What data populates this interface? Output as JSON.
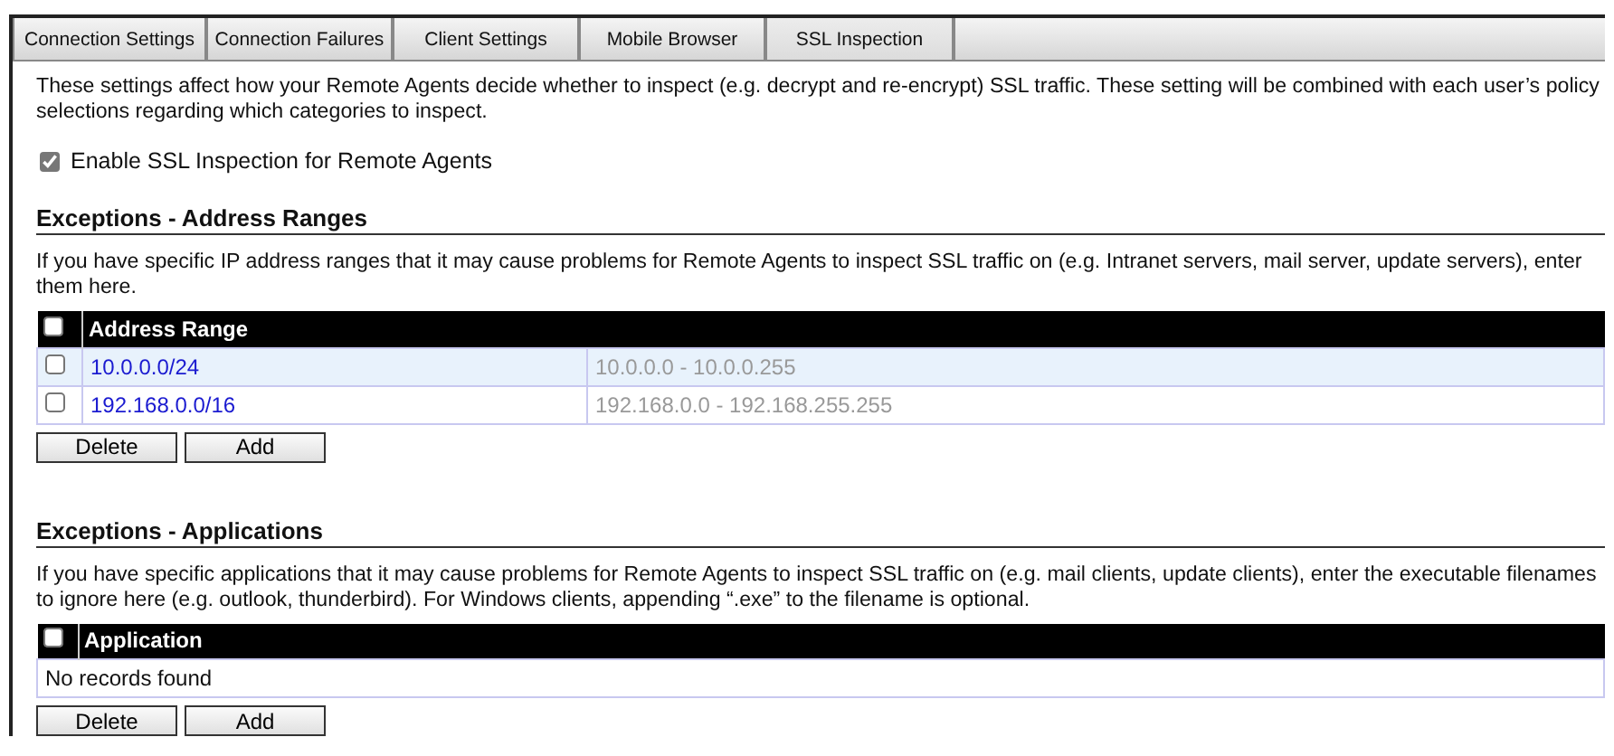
{
  "tabs": [
    {
      "label": "Connection Settings",
      "selected": false
    },
    {
      "label": "Connection Failures",
      "selected": false
    },
    {
      "label": "Client Settings",
      "selected": false
    },
    {
      "label": "Mobile Browser",
      "selected": false
    },
    {
      "label": "SSL Inspection",
      "selected": true
    }
  ],
  "intro": "These settings affect how your Remote Agents decide whether to inspect (e.g. decrypt and re-encrypt) SSL traffic. These setting will be combined with each user’s policy selections regarding which categories to inspect.",
  "enable_option": {
    "label": "Enable SSL Inspection for Remote Agents",
    "checked": true
  },
  "sections": [
    {
      "heading": "Exceptions - Address Ranges",
      "description": "If you have specific IP address ranges that it may cause problems for Remote Agents to inspect SSL traffic on (e.g. Intranet servers, mail server, update servers), enter them here.",
      "table": {
        "header_checked": false,
        "column": "Address Range",
        "rows": [
          {
            "checked": false,
            "highlighted": true,
            "range": "10.0.0.0/24",
            "span": "10.0.0.0 - 10.0.0.255"
          },
          {
            "checked": false,
            "highlighted": false,
            "range": "192.168.0.0/16",
            "span": "192.168.0.0 - 192.168.255.255"
          }
        ]
      },
      "buttons": [
        "Delete",
        "Add"
      ]
    },
    {
      "heading": "Exceptions - Applications",
      "description": "If you have specific applications that it may cause problems for Remote Agents to inspect SSL traffic on (e.g. mail clients, update clients), enter the executable filenames to ignore here (e.g. outlook, thunderbird). For Windows clients, appending “.exe” to the filename is optional.",
      "table": {
        "header_checked": false,
        "column": "Application",
        "empty_text": "No records found"
      },
      "buttons": [
        "Delete",
        "Add"
      ]
    }
  ]
}
